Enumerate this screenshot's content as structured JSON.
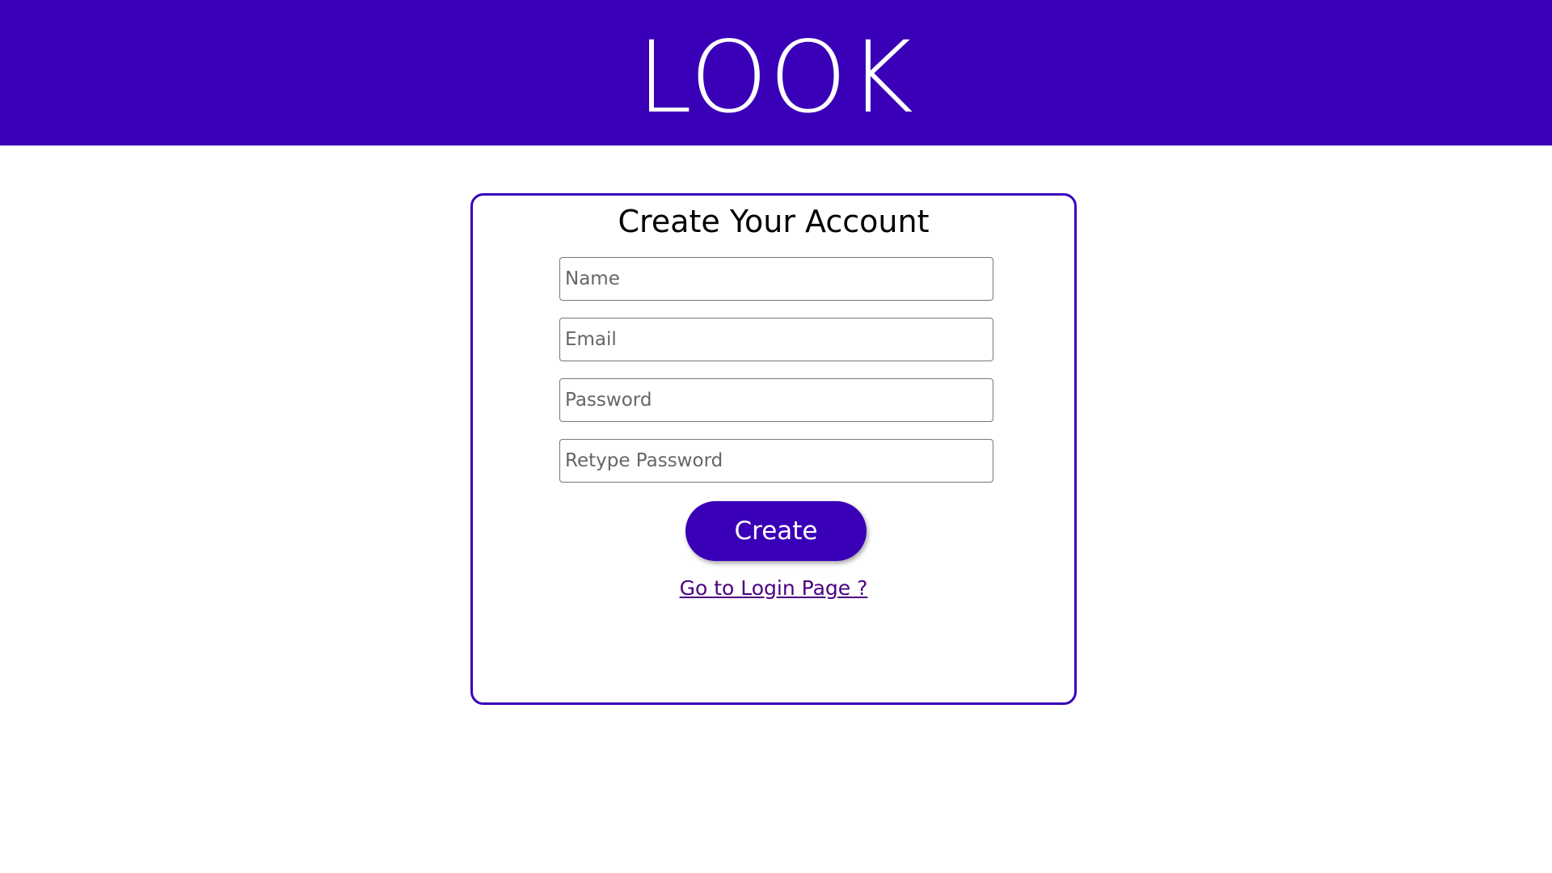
{
  "header": {
    "logo_text": "LOOK"
  },
  "form": {
    "title": "Create Your Account",
    "name_placeholder": "Name",
    "email_placeholder": "Email",
    "password_placeholder": "Password",
    "retype_password_placeholder": "Retype Password",
    "create_label": "Create",
    "login_link_label": "Go to Login Page ?"
  },
  "colors": {
    "brand": "#3a00b7",
    "link": "#4b0082",
    "background": "#ffffff"
  }
}
